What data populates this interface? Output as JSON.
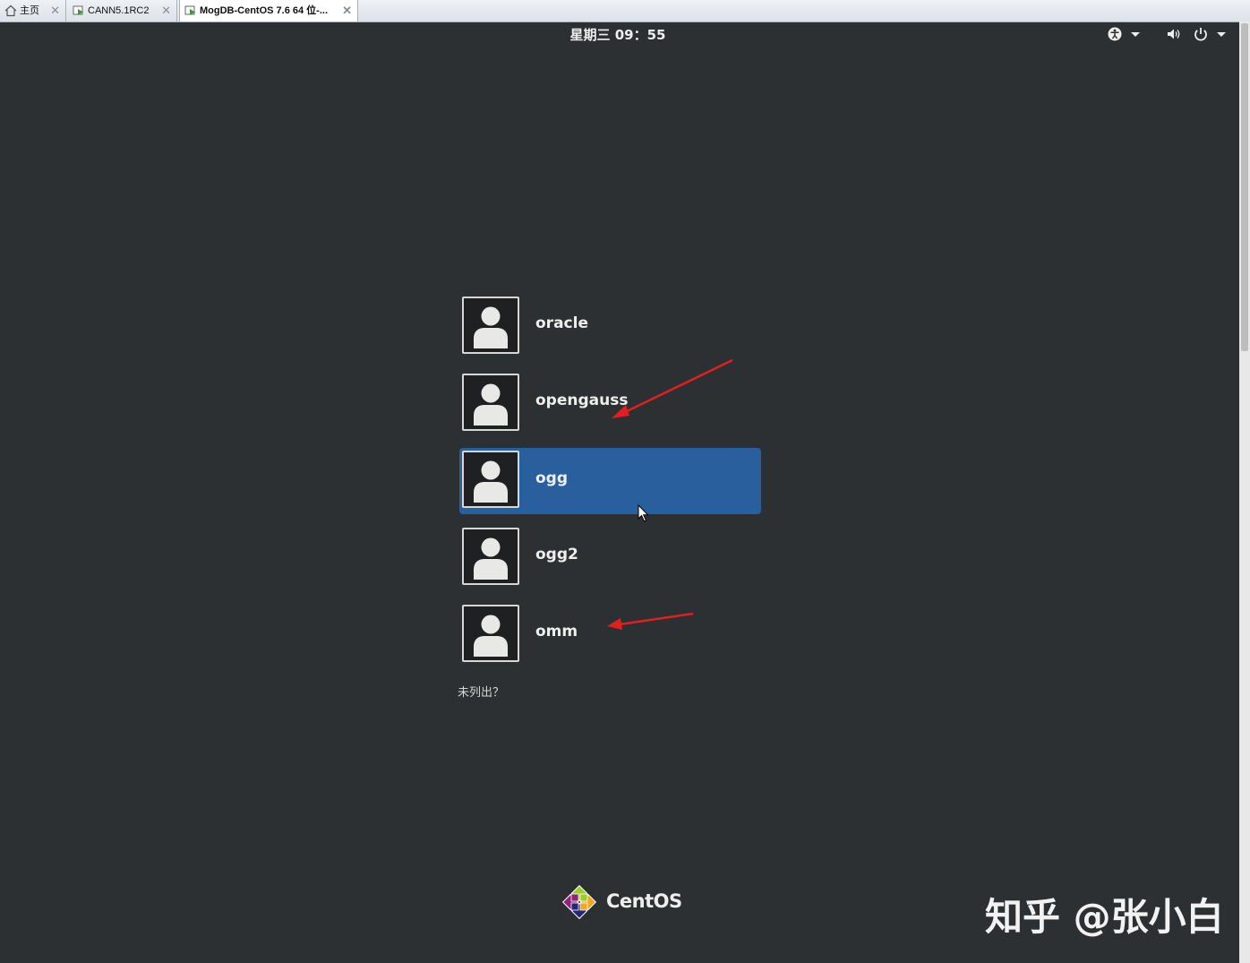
{
  "tabs": [
    {
      "label": "主页",
      "icon": "home-icon"
    },
    {
      "label": "CANN5.1RC2",
      "icon": "vm-icon"
    },
    {
      "label": "MogDB-CentOS 7.6 64 位-...",
      "icon": "vm-icon",
      "active": true
    }
  ],
  "topbar": {
    "clock": "星期三 09：55",
    "icons": [
      "accessibility-icon",
      "volume-icon",
      "power-icon"
    ]
  },
  "users": [
    {
      "name": "oracle",
      "selected": false
    },
    {
      "name": "opengauss",
      "selected": false
    },
    {
      "name": "ogg",
      "selected": true
    },
    {
      "name": "ogg2",
      "selected": false
    },
    {
      "name": "omm",
      "selected": false
    }
  ],
  "not_listed": "未列出？",
  "brand": "CentOS",
  "watermark": "知乎 @张小白",
  "colors": {
    "background": "#2c3033",
    "selection": "#2a5f9e",
    "arrow": "#e02020"
  }
}
